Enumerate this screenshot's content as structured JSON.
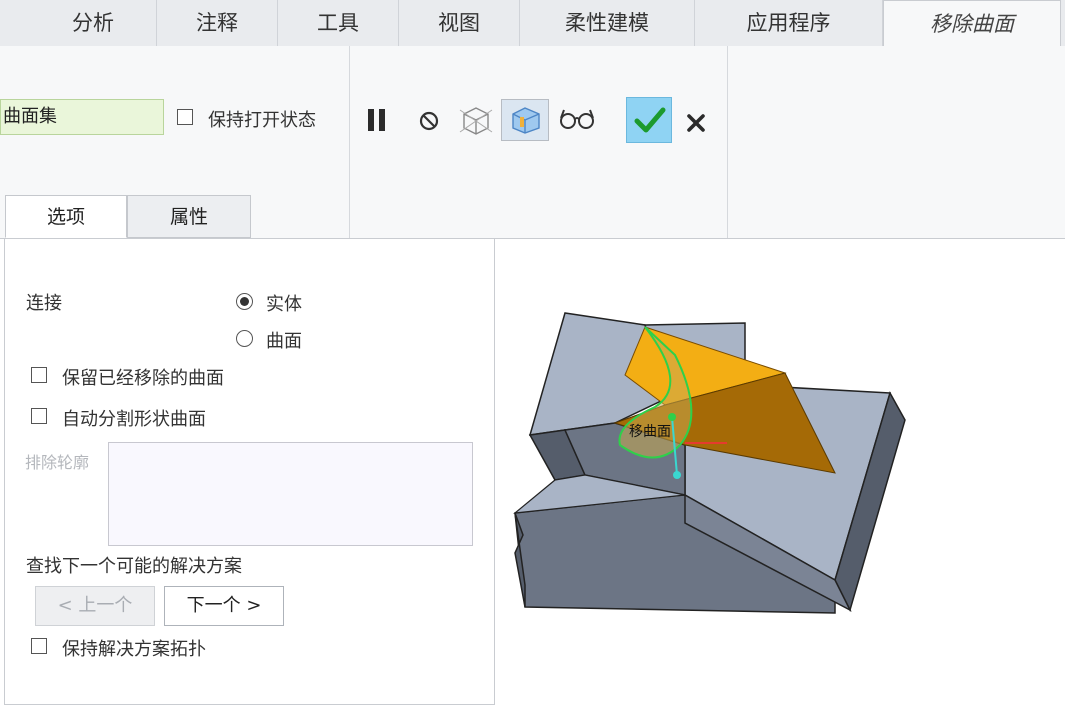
{
  "tabs": [
    {
      "label": "分析"
    },
    {
      "label": "注释"
    },
    {
      "label": "工具"
    },
    {
      "label": "视图"
    },
    {
      "label": "柔性建模"
    },
    {
      "label": "应用程序"
    },
    {
      "label": "移除曲面",
      "active": true
    }
  ],
  "ribbon": {
    "collector_value": "曲面集",
    "keep_open_label": "保持打开状态",
    "keep_open_checked": false,
    "tools": [
      "pause-icon",
      "no-preview-icon",
      "geometry-preview-icon",
      "feature-preview-icon",
      "verify-glasses-icon"
    ],
    "ok_icon": "checkmark-icon",
    "cancel_icon": "close-icon"
  },
  "subtabs": [
    {
      "label": "选项",
      "active": true
    },
    {
      "label": "属性",
      "active": false
    }
  ],
  "options": {
    "attach_label": "连接",
    "attach_options": [
      {
        "label": "实体",
        "selected": true
      },
      {
        "label": "曲面",
        "selected": false
      }
    ],
    "keep_removed_label": "保留已经移除的曲面",
    "keep_removed_checked": false,
    "auto_split_label": "自动分割形状曲面",
    "auto_split_checked": false,
    "exclude_contours_label": "排除轮廓",
    "find_next_label": "查找下一个可能的解决方案",
    "prev_label": "< 上一个",
    "next_label": "下一个 >",
    "keep_topology_label": "保持解决方案拓扑",
    "keep_topology_checked": false
  },
  "viewport": {
    "surface_tag": "移曲面",
    "colors": {
      "solid_top": "#a9b4c6",
      "solid_side": "#6c7585",
      "solid_dark": "#555d6b",
      "removed_face_light": "#f3ae14",
      "removed_face_dark": "#a56a06",
      "highlight": "#2fd04a",
      "handle": "#3ad7d0"
    }
  }
}
